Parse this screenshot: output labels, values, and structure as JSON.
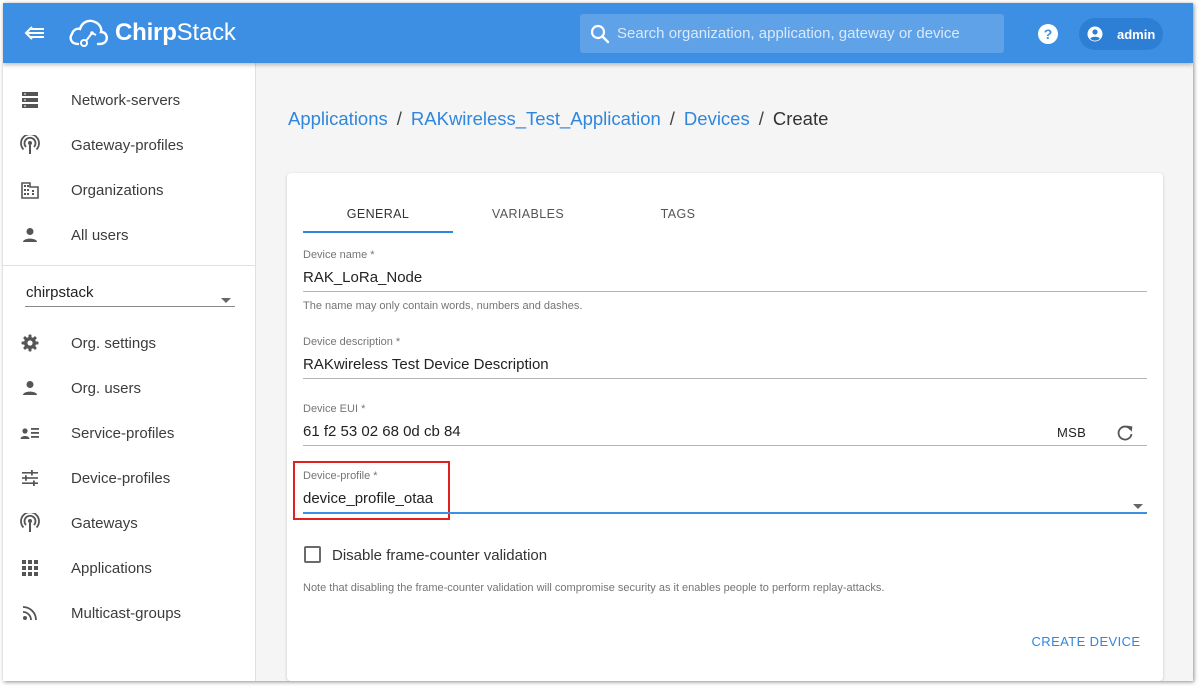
{
  "app": {
    "name_bold": "Chirp",
    "name_rest": "Stack"
  },
  "topbar": {
    "search_placeholder": "Search organization, application, gateway or device",
    "user": "admin"
  },
  "sidebar": {
    "global_items": [
      {
        "label": "Network-servers",
        "icon": "server-icon"
      },
      {
        "label": "Gateway-profiles",
        "icon": "antenna-icon"
      },
      {
        "label": "Organizations",
        "icon": "building-icon"
      },
      {
        "label": "All users",
        "icon": "person-icon"
      }
    ],
    "org_select": "chirpstack",
    "org_items": [
      {
        "label": "Org. settings",
        "icon": "gear-icon"
      },
      {
        "label": "Org. users",
        "icon": "person-icon"
      },
      {
        "label": "Service-profiles",
        "icon": "person-list-icon"
      },
      {
        "label": "Device-profiles",
        "icon": "tune-icon"
      },
      {
        "label": "Gateways",
        "icon": "antenna-icon"
      },
      {
        "label": "Applications",
        "icon": "apps-grid-icon"
      },
      {
        "label": "Multicast-groups",
        "icon": "rss-icon"
      }
    ]
  },
  "breadcrumb": {
    "items": [
      "Applications",
      "RAKwireless_Test_Application",
      "Devices"
    ],
    "current": "Create",
    "separator": "/"
  },
  "tabs": [
    "GENERAL",
    "VARIABLES",
    "TAGS"
  ],
  "form": {
    "device_name": {
      "label": "Device name *",
      "value": "RAK_LoRa_Node",
      "help": "The name may only contain words, numbers and dashes."
    },
    "device_description": {
      "label": "Device description *",
      "value": "RAKwireless Test Device Description"
    },
    "device_eui": {
      "label": "Device EUI *",
      "value": "61 f2 53 02 68 0d cb 84",
      "byte_order": "MSB"
    },
    "device_profile": {
      "label": "Device-profile *",
      "value": "device_profile_otaa"
    },
    "frame_counter": {
      "label": "Disable frame-counter validation",
      "checked": false,
      "note": "Note that disabling the frame-counter validation will compromise security as it enables people to perform replay-attacks."
    },
    "submit_label": "CREATE DEVICE"
  },
  "colors": {
    "primary": "#3d8fe3",
    "link": "#2f86dd",
    "highlight": "#e0211d"
  }
}
